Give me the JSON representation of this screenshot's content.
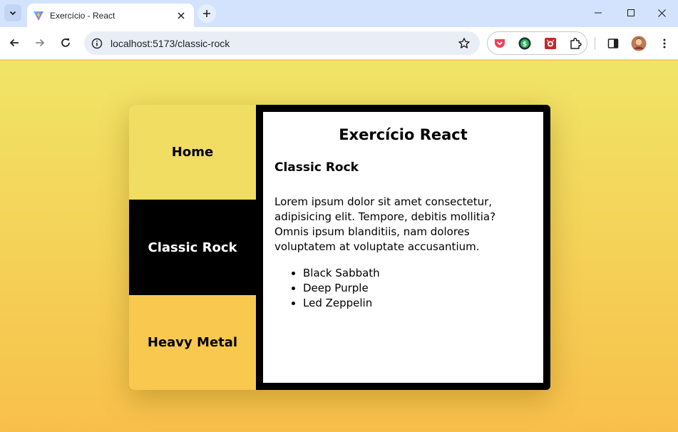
{
  "browser": {
    "tab": {
      "title": "Exercício - React",
      "favicon": "vite-icon"
    },
    "url": "localhost:5173/classic-rock",
    "extensions": [
      "pocket-icon",
      "dollar-extension-icon",
      "bug-extension-icon",
      "puzzle-extensions-icon"
    ]
  },
  "app": {
    "heading": "Exercício React",
    "nav": [
      {
        "label": "Home",
        "active": false
      },
      {
        "label": "Classic Rock",
        "active": true
      },
      {
        "label": "Heavy Metal",
        "active": false
      }
    ],
    "section": {
      "title": "Classic Rock",
      "text": "Lorem ipsum dolor sit amet consectetur, adipisicing elit. Tempore, debitis mollitia? Omnis ipsum blanditiis, nam dolores voluptatem at voluptate accusantium.",
      "bands": [
        "Black Sabbath",
        "Deep Purple",
        "Led Zeppelin"
      ]
    }
  },
  "colors": {
    "home_bg": "#f0dd62",
    "active_bg": "#000000",
    "metal_bg": "#f8c94e",
    "page_gradient_top": "#f0e466",
    "page_gradient_bottom": "#f8c04a"
  }
}
